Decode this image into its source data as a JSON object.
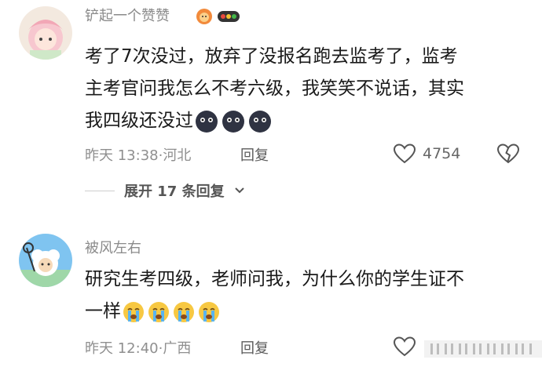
{
  "comments": [
    {
      "username": "铲起一个赞赞",
      "text_lines": [
        "考了7次没过，放弃了没报名跑去监考了，监考",
        "主考官问我怎么不考六级，我笑笑不说话，其实",
        "我四级还没过"
      ],
      "emoji": [
        "dark-face-emoji",
        "dark-face-emoji",
        "dark-face-emoji"
      ],
      "time": "昨天 13:38",
      "location": "河北",
      "reply_label": "回复",
      "likes": "4754",
      "expand_label": "展开 17 条回复"
    },
    {
      "username": "被风左右",
      "text_lines": [
        "研究生考四级，老师问我，为什么你的学生证不",
        "一样"
      ],
      "emoji": [
        "crying-face-emoji",
        "crying-face-emoji",
        "crying-face-emoji",
        "crying-face-emoji"
      ],
      "time": "昨天 12:40",
      "location": "广西",
      "reply_label": "回复"
    }
  ],
  "colors": {
    "text": "#1a1a1a",
    "meta": "#8f8f8f",
    "username": "#8a8a8a"
  }
}
